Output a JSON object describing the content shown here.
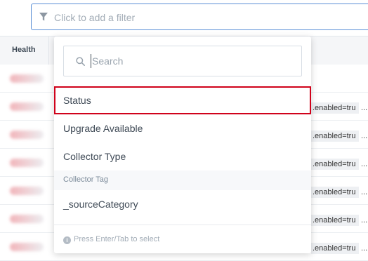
{
  "filter_bar": {
    "placeholder": "Click to add a filter",
    "icon": "filter-icon"
  },
  "table": {
    "columns": [
      "Health"
    ],
    "rows": [
      {
        "config": ".enabled=tru",
        "more": "..."
      },
      {
        "config": ".enabled=tru",
        "more": "..."
      },
      {
        "config": ".enabled=tru",
        "more": "..."
      },
      {
        "config": ".enabled=tru",
        "more": "..."
      },
      {
        "config": ".enabled=tru",
        "more": "..."
      },
      {
        "config": ".enabled=tru",
        "more": "..."
      }
    ]
  },
  "dropdown": {
    "search_placeholder": "Search",
    "options": [
      {
        "label": "Status",
        "selected": true
      },
      {
        "label": "Upgrade Available",
        "selected": false
      },
      {
        "label": "Collector Type",
        "selected": false
      }
    ],
    "group_header": "Collector Tag",
    "group_options": [
      {
        "label": "_sourceCategory"
      }
    ],
    "hint": "Press Enter/Tab to select"
  },
  "colors": {
    "accent_border": "#5b8fd6",
    "selected_outline": "#d0021b",
    "text": "#3f4a56",
    "muted_text": "#a3adb7"
  }
}
